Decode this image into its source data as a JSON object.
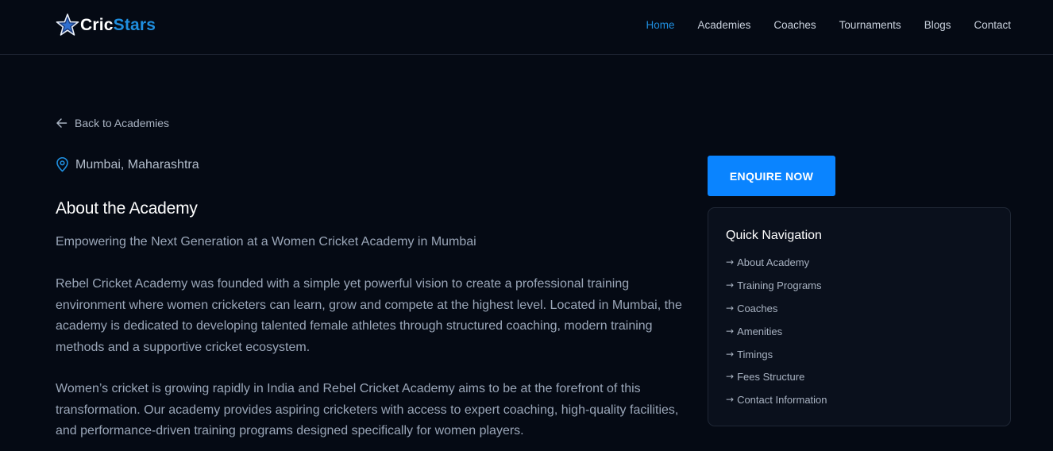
{
  "brand": {
    "part1": "Cric",
    "part2": "Stars"
  },
  "nav": {
    "items": [
      {
        "label": "Home",
        "active": true
      },
      {
        "label": "Academies",
        "active": false
      },
      {
        "label": "Coaches",
        "active": false
      },
      {
        "label": "Tournaments",
        "active": false
      },
      {
        "label": "Blogs",
        "active": false
      },
      {
        "label": "Contact",
        "active": false
      }
    ]
  },
  "back_link": "Back to Academies",
  "location": "Mumbai, Maharashtra",
  "about": {
    "title": "About the Academy",
    "subtitle": "Empowering the Next Generation at a Women Cricket Academy in Mumbai",
    "paragraphs": [
      "Rebel Cricket Academy was founded with a simple yet powerful vision to create a professional training environment where women cricketers can learn, grow and compete at the highest level. Located in Mumbai, the academy is dedicated to developing talented female athletes through structured coaching, modern training methods and a supportive cricket ecosystem.",
      "Women’s cricket is growing rapidly in India and Rebel Cricket Academy aims to be at the forefront of this transformation. Our academy provides aspiring cricketers with access to expert coaching, high-quality facilities, and performance-driven training programs designed specifically for women players."
    ]
  },
  "sidebar": {
    "enquire_label": "ENQUIRE NOW",
    "quick_nav_title": "Quick Navigation",
    "arrow": "→",
    "items": [
      "About Academy",
      "Training Programs",
      "Coaches",
      "Amenities",
      "Timings",
      "Fees Structure",
      "Contact Information"
    ]
  },
  "colors": {
    "background": "#050a14",
    "accent": "#1f8fe0",
    "button": "#0a84ff"
  }
}
